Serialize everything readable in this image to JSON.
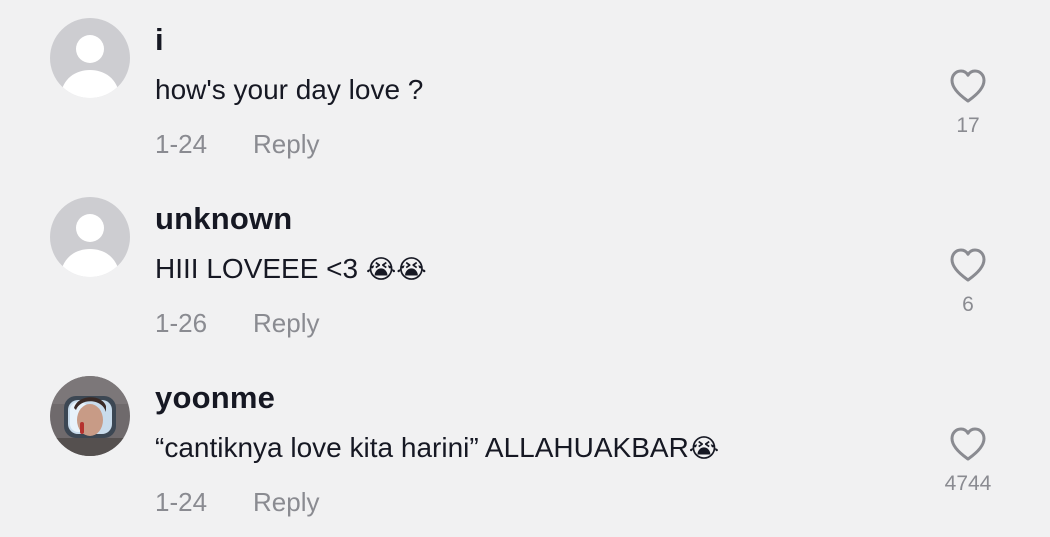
{
  "colors": {
    "background": "#f1f1f2",
    "text_primary": "#161823",
    "text_secondary": "#8a8b91",
    "default_avatar": "#cdcdd1"
  },
  "comments": [
    {
      "username": "i",
      "text": "how's your day love ?",
      "date": "1-24",
      "reply_label": "Reply",
      "like_count": "17",
      "avatar": "default-avatar-icon"
    },
    {
      "username": "unknown",
      "text": "HIII LOVEEE <3 ",
      "emoji": "😭😭",
      "date": "1-26",
      "reply_label": "Reply",
      "like_count": "6",
      "avatar": "default-avatar-icon"
    },
    {
      "username": "yoonme",
      "text": "“cantiknya love kita harini” ALLAHUAKBAR",
      "emoji": "😭",
      "date": "1-24",
      "reply_label": "Reply",
      "like_count": "4744",
      "avatar": "photo-avatar"
    }
  ]
}
